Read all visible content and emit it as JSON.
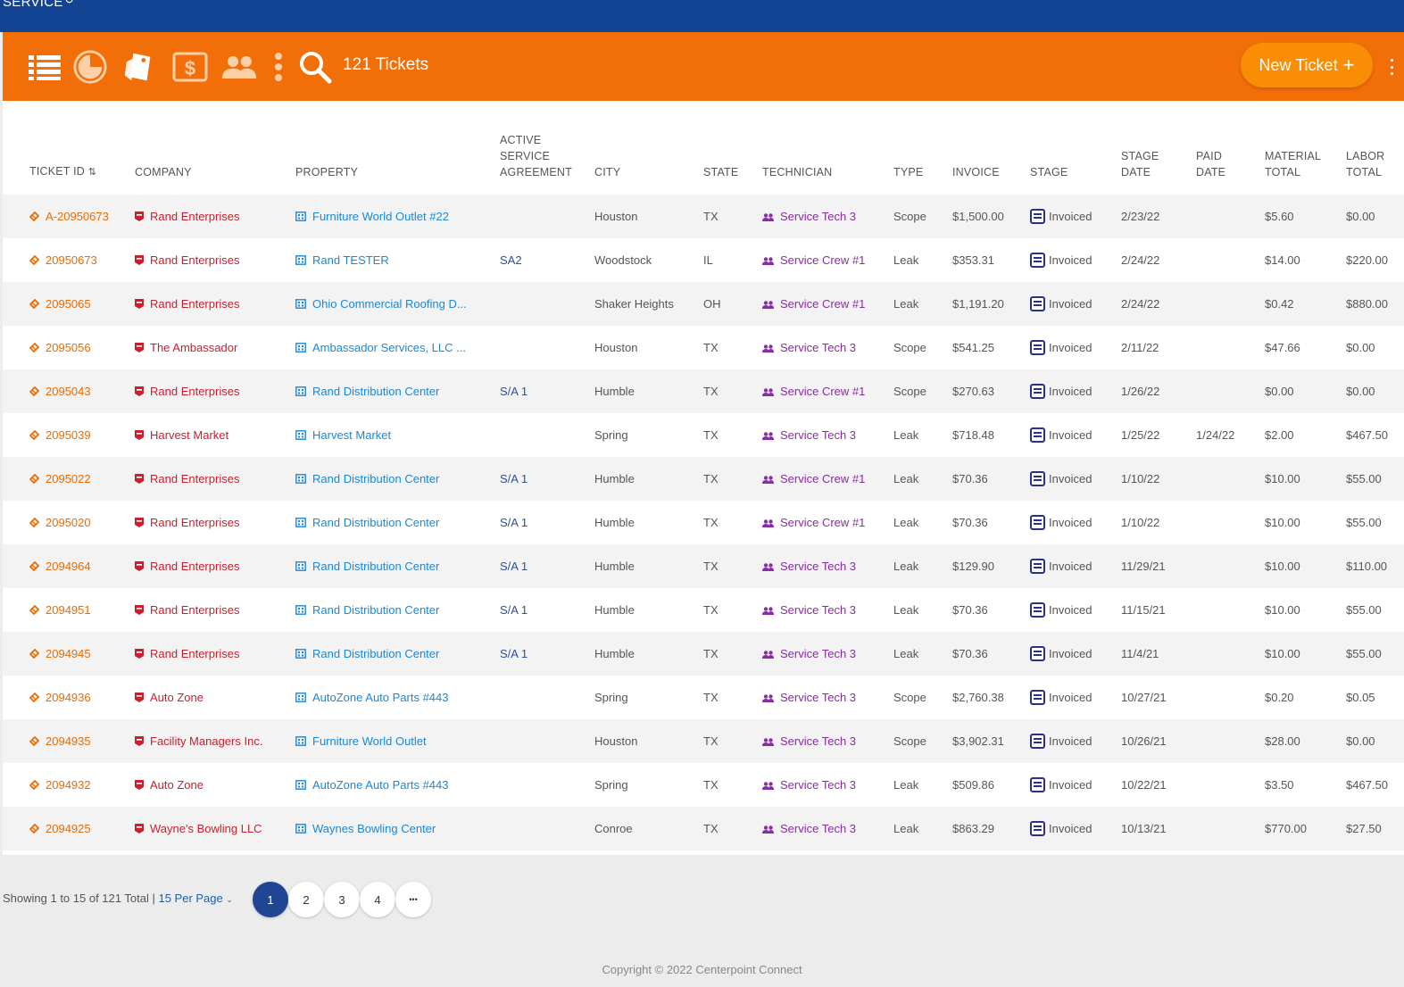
{
  "topbar": {
    "title": "SERVICE",
    "title_icon": "refresh-icon"
  },
  "toolbar": {
    "icons": [
      "list-icon",
      "pie-chart-icon",
      "tags-icon",
      "dollar-icon",
      "people-icon",
      "vertical-dots-icon",
      "search-icon"
    ],
    "count_label": "121 Tickets",
    "new_ticket_label": "New Ticket",
    "more_icon": "more-options-icon"
  },
  "columns": {
    "ticket_id": "TICKET ID",
    "company": "COMPANY",
    "property": "PROPERTY",
    "active_sa": [
      "ACTIVE",
      "SERVICE",
      "AGREEMENT"
    ],
    "city": "CITY",
    "state": "STATE",
    "technician": "TECHNICIAN",
    "type": "TYPE",
    "invoice": "INVOICE",
    "stage": "STAGE",
    "stage_date": [
      "STAGE",
      "DATE"
    ],
    "paid_date": [
      "PAID",
      "DATE"
    ],
    "material_total": [
      "MATERIAL",
      "TOTAL"
    ],
    "labor_total": [
      "LABOR",
      "TOTAL"
    ]
  },
  "rows": [
    {
      "id": "A-20950673",
      "company": "Rand Enterprises",
      "property": "Furniture World Outlet #22",
      "sa": "",
      "city": "Houston",
      "state": "TX",
      "tech": "Service Tech 3",
      "type": "Scope",
      "invoice": "$1,500.00",
      "stage": "Invoiced",
      "stage_date": "2/23/22",
      "paid_date": "",
      "material": "$5.60",
      "labor": "$0.00"
    },
    {
      "id": "20950673",
      "company": "Rand Enterprises",
      "property": "Rand TESTER",
      "sa": "SA2",
      "city": "Woodstock",
      "state": "IL",
      "tech": "Service Crew #1",
      "type": "Leak",
      "invoice": "$353.31",
      "stage": "Invoiced",
      "stage_date": "2/24/22",
      "paid_date": "",
      "material": "$14.00",
      "labor": "$220.00"
    },
    {
      "id": "2095065",
      "company": "Rand Enterprises",
      "property": "Ohio Commercial Roofing D...",
      "sa": "",
      "city": "Shaker Heights",
      "state": "OH",
      "tech": "Service Crew #1",
      "type": "Leak",
      "invoice": "$1,191.20",
      "stage": "Invoiced",
      "stage_date": "2/24/22",
      "paid_date": "",
      "material": "$0.42",
      "labor": "$880.00"
    },
    {
      "id": "2095056",
      "company": "The Ambassador",
      "property": "Ambassador Services, LLC ...",
      "sa": "",
      "city": "Houston",
      "state": "TX",
      "tech": "Service Tech 3",
      "type": "Scope",
      "invoice": "$541.25",
      "stage": "Invoiced",
      "stage_date": "2/11/22",
      "paid_date": "",
      "material": "$47.66",
      "labor": "$0.00"
    },
    {
      "id": "2095043",
      "company": "Rand Enterprises",
      "property": "Rand Distribution Center",
      "sa": "S/A 1",
      "city": "Humble",
      "state": "TX",
      "tech": "Service Crew #1",
      "type": "Scope",
      "invoice": "$270.63",
      "stage": "Invoiced",
      "stage_date": "1/26/22",
      "paid_date": "",
      "material": "$0.00",
      "labor": "$0.00"
    },
    {
      "id": "2095039",
      "company": "Harvest Market",
      "property": "Harvest Market",
      "sa": "",
      "city": "Spring",
      "state": "TX",
      "tech": "Service Tech 3",
      "type": "Leak",
      "invoice": "$718.48",
      "stage": "Invoiced",
      "stage_date": "1/25/22",
      "paid_date": "1/24/22",
      "material": "$2.00",
      "labor": "$467.50"
    },
    {
      "id": "2095022",
      "company": "Rand Enterprises",
      "property": "Rand Distribution Center",
      "sa": "S/A 1",
      "city": "Humble",
      "state": "TX",
      "tech": "Service Crew #1",
      "type": "Leak",
      "invoice": "$70.36",
      "stage": "Invoiced",
      "stage_date": "1/10/22",
      "paid_date": "",
      "material": "$10.00",
      "labor": "$55.00"
    },
    {
      "id": "2095020",
      "company": "Rand Enterprises",
      "property": "Rand Distribution Center",
      "sa": "S/A 1",
      "city": "Humble",
      "state": "TX",
      "tech": "Service Crew #1",
      "type": "Leak",
      "invoice": "$70.36",
      "stage": "Invoiced",
      "stage_date": "1/10/22",
      "paid_date": "",
      "material": "$10.00",
      "labor": "$55.00"
    },
    {
      "id": "2094964",
      "company": "Rand Enterprises",
      "property": "Rand Distribution Center",
      "sa": "S/A 1",
      "city": "Humble",
      "state": "TX",
      "tech": "Service Tech 3",
      "type": "Leak",
      "invoice": "$129.90",
      "stage": "Invoiced",
      "stage_date": "11/29/21",
      "paid_date": "",
      "material": "$10.00",
      "labor": "$110.00"
    },
    {
      "id": "2094951",
      "company": "Rand Enterprises",
      "property": "Rand Distribution Center",
      "sa": "S/A 1",
      "city": "Humble",
      "state": "TX",
      "tech": "Service Tech 3",
      "type": "Leak",
      "invoice": "$70.36",
      "stage": "Invoiced",
      "stage_date": "11/15/21",
      "paid_date": "",
      "material": "$10.00",
      "labor": "$55.00"
    },
    {
      "id": "2094945",
      "company": "Rand Enterprises",
      "property": "Rand Distribution Center",
      "sa": "S/A 1",
      "city": "Humble",
      "state": "TX",
      "tech": "Service Tech 3",
      "type": "Leak",
      "invoice": "$70.36",
      "stage": "Invoiced",
      "stage_date": "11/4/21",
      "paid_date": "",
      "material": "$10.00",
      "labor": "$55.00"
    },
    {
      "id": "2094936",
      "company": "Auto Zone",
      "property": "AutoZone Auto Parts #443",
      "sa": "",
      "city": "Spring",
      "state": "TX",
      "tech": "Service Tech 3",
      "type": "Scope",
      "invoice": "$2,760.38",
      "stage": "Invoiced",
      "stage_date": "10/27/21",
      "paid_date": "",
      "material": "$0.20",
      "labor": "$0.05"
    },
    {
      "id": "2094935",
      "company": "Facility Managers Inc.",
      "property": "Furniture World Outlet",
      "sa": "",
      "city": "Houston",
      "state": "TX",
      "tech": "Service Tech 3",
      "type": "Scope",
      "invoice": "$3,902.31",
      "stage": "Invoiced",
      "stage_date": "10/26/21",
      "paid_date": "",
      "material": "$28.00",
      "labor": "$0.00"
    },
    {
      "id": "2094932",
      "company": "Auto Zone",
      "property": "AutoZone Auto Parts #443",
      "sa": "",
      "city": "Spring",
      "state": "TX",
      "tech": "Service Tech 3",
      "type": "Leak",
      "invoice": "$509.86",
      "stage": "Invoiced",
      "stage_date": "10/22/21",
      "paid_date": "",
      "material": "$3.50",
      "labor": "$467.50"
    },
    {
      "id": "2094925",
      "company": "Wayne's Bowling LLC",
      "property": "Waynes Bowling Center",
      "sa": "",
      "city": "Conroe",
      "state": "TX",
      "tech": "Service Tech 3",
      "type": "Leak",
      "invoice": "$863.29",
      "stage": "Invoiced",
      "stage_date": "10/13/21",
      "paid_date": "",
      "material": "$770.00",
      "labor": "$27.50"
    }
  ],
  "footer": {
    "showing": "Showing 1 to 15 of 121 Total",
    "separator": "|",
    "per_page": "15 Per Page",
    "pages": [
      "1",
      "2",
      "3",
      "4",
      "•••"
    ],
    "current_page": 1,
    "copyright": "Copyright © 2022 Centerpoint Connect"
  },
  "colors": {
    "topbar": "#134393",
    "toolbar": "#f26e08",
    "ticket_link": "#ec6a00",
    "company_link": "#c8202e",
    "property_link": "#1b87d8",
    "technician_link": "#8a2ca5",
    "active_page": "#1f4594"
  }
}
